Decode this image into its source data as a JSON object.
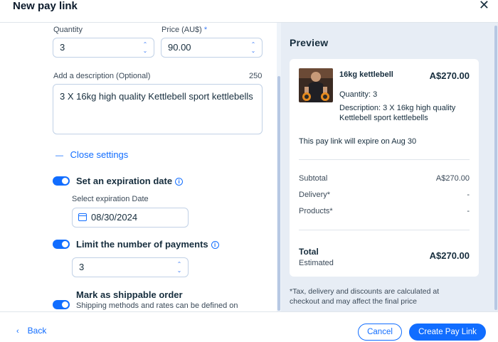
{
  "header": {
    "title": "New pay link",
    "close_glyph": "✕"
  },
  "form": {
    "quantity": {
      "label": "Quantity",
      "value": "3"
    },
    "price": {
      "label": "Price (AU$)",
      "required_mark": "*",
      "value": "90.00"
    },
    "description": {
      "label": "Add a description (Optional)",
      "char_limit": "250",
      "value": "3 X 16kg high quality Kettlebell sport kettlebells"
    },
    "close_settings": {
      "dash": "—",
      "label": "Close settings"
    },
    "expiration": {
      "label": "Set an expiration date",
      "enabled": true,
      "date_label": "Select expiration Date",
      "date_value": "08/30/2024"
    },
    "limit_payments": {
      "label": "Limit the number of payments",
      "enabled": true,
      "value": "3"
    },
    "shippable": {
      "label": "Mark as shippable order",
      "enabled": true,
      "description": "Shipping methods and rates can be defined on"
    }
  },
  "preview": {
    "title": "Preview",
    "product": {
      "name": "16kg kettlebell",
      "price": "A$270.00",
      "quantity": "Quantity: 3",
      "description_line1": "Description: 3 X 16kg high quality",
      "description_line2": "Kettlebell sport kettlebells"
    },
    "expiry_text": "This pay link will expire on Aug 30",
    "summary": {
      "subtotal_label": "Subtotal",
      "subtotal_value": "A$270.00",
      "delivery_label": "Delivery*",
      "delivery_value": "-",
      "products_label": "Products*",
      "products_value": "-"
    },
    "total": {
      "label": "Total",
      "sublabel": "Estimated",
      "value": "A$270.00"
    },
    "note_line1": "*Tax, delivery and discounts are calculated at",
    "note_line2": "checkout and may affect the final price"
  },
  "footer": {
    "back_chevron": "‹",
    "back_label": "Back",
    "cancel_label": "Cancel",
    "create_label": "Create Pay Link"
  },
  "icons": {
    "stepper_up": "⌃",
    "stepper_down": "⌄",
    "info": "i"
  },
  "colors": {
    "accent": "#116dff",
    "preview_bg": "#e7edf5"
  }
}
